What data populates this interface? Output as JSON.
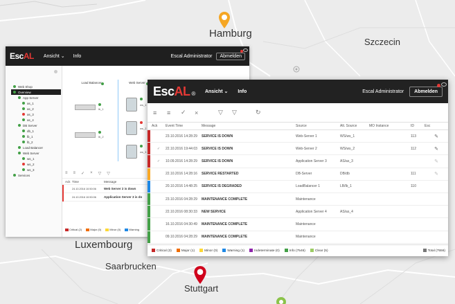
{
  "map": {
    "cities": {
      "hamburg": "Hamburg",
      "szczecin": "Szczecin",
      "luxembourg_country": "LUXEMBOURG",
      "luxembourg": "Luxembourg",
      "saarbrucken": "Saarbrucken",
      "stuttgart": "Stuttgart"
    },
    "pin_colors": {
      "hamburg": "#f5a623",
      "stuttgart": "#d0021b",
      "bottom": "#8bc34a"
    }
  },
  "back_window": {
    "logo_esc": "Esc",
    "logo_al": "AL",
    "logo_reg": "®",
    "nav_view": "Ansicht ⌄",
    "nav_info": "Info",
    "admin": "Escal Administrator",
    "logout": "Abmelden",
    "tree": [
      {
        "label": "Web Shop",
        "level": 1,
        "status": "green"
      },
      {
        "label": "Overview",
        "level": 1,
        "status": "green",
        "selected": true
      },
      {
        "label": "App Server",
        "level": 2,
        "status": "green"
      },
      {
        "label": "as_1",
        "level": 3,
        "status": "green"
      },
      {
        "label": "as_2",
        "level": 3,
        "status": "green"
      },
      {
        "label": "as_3",
        "level": 3,
        "status": "red"
      },
      {
        "label": "as_4",
        "level": 3,
        "status": "green"
      },
      {
        "label": "DB Server",
        "level": 2,
        "status": "green"
      },
      {
        "label": "db_1",
        "level": 3,
        "status": "green"
      },
      {
        "label": "lb_1",
        "level": 3,
        "status": "green"
      },
      {
        "label": "lb_2",
        "level": 3,
        "status": "green"
      },
      {
        "label": "Load Balancer",
        "level": 2,
        "status": "green"
      },
      {
        "label": "Web Server",
        "level": 2,
        "status": "green"
      },
      {
        "label": "ws_1",
        "level": 3,
        "status": "green"
      },
      {
        "label": "ws_2",
        "level": 3,
        "status": "red"
      },
      {
        "label": "ws_3",
        "level": 3,
        "status": "green"
      },
      {
        "label": "Services",
        "level": 1,
        "status": "green"
      }
    ],
    "diagram": {
      "col_lb": "Load Balancer",
      "col_web": "Web Server",
      "lb_1": "lb_1",
      "lb_2": "lb_2",
      "ws_1": "ws_1",
      "ws_2": "ws_2",
      "ws_3": "ws_3"
    },
    "alarm_columns": {
      "ack": "Ack",
      "time": "Time",
      "message": "Message"
    },
    "alarm_rows": [
      {
        "time": "24.10.2016 10:50:06",
        "message": "Web Server 2 is down"
      },
      {
        "time": "24.10.2016 10:50:06",
        "message": "Application Server 3 is do"
      }
    ],
    "legend": [
      "Critical (2)",
      "Major (0)",
      "Minor (0)",
      "Warning"
    ]
  },
  "front_window": {
    "logo_esc": "Esc",
    "logo_al": "AL",
    "logo_reg": "®",
    "nav_view": "Ansicht ⌄",
    "nav_info": "Info",
    "admin": "Escal Administrator",
    "logout": "Abmelden",
    "toolbar_icons": [
      "list-filter-icon",
      "list-filter-alt-icon",
      "check-icon",
      "close-icon",
      "funnel-icon",
      "funnel-clear-icon",
      "refresh-icon"
    ],
    "columns": {
      "ack": "Ack",
      "time": "Event Time",
      "message": "Message",
      "source": "Source",
      "alias": "Alt. Source",
      "mo": "MO Instance",
      "id": "ID",
      "esc": "Esc"
    },
    "rows": [
      {
        "severity": "#c62828",
        "ack": "",
        "time": "23.10.2016 14:28:29",
        "message": "SERVICE IS DOWN",
        "source": "Web-Server 1",
        "alias": "WS/ws_1",
        "mo": "",
        "id": "113",
        "esc": "pencil"
      },
      {
        "severity": "#c62828",
        "ack": "✓",
        "time": "22.10.2016 19:44:03",
        "message": "SERVICE IS DOWN",
        "source": "Web-Server 2",
        "alias": "WS/ws_2",
        "mo": "",
        "id": "112",
        "esc": "pencil"
      },
      {
        "severity": "#c62828",
        "ack": "✓",
        "time": "10.09.2016 14:28:29",
        "message": "SERVICE IS DOWN",
        "source": "Application Server 3",
        "alias": "AS/as_3",
        "mo": "",
        "id": "",
        "esc": "pencil-light"
      },
      {
        "severity": "#f9a825",
        "ack": "",
        "time": "22.10.2016 14:28:16",
        "message": "SERVICE RESTARTED",
        "source": "DB-Server",
        "alias": "DB/db",
        "mo": "",
        "id": "111",
        "esc": "pencil-light"
      },
      {
        "severity": "#1e88e5",
        "ack": "",
        "time": "20.10.2016 14:48:25",
        "message": "SERVICE IS DEGRADED",
        "source": "LoadBalancer 1",
        "alias": "LB/lb_1",
        "mo": "",
        "id": "110",
        "esc": ""
      },
      {
        "severity": "#43a047",
        "ack": "",
        "time": "23.10.2016 04:28:29",
        "message": "MAINTENANCE COMPLETE",
        "source": "Maintenance",
        "alias": "",
        "mo": "",
        "id": "",
        "esc": ""
      },
      {
        "severity": "#43a047",
        "ack": "",
        "time": "22.10.2016 08:30:33",
        "message": "NEW SERVICE",
        "source": "Application Server 4",
        "alias": "AS/as_4",
        "mo": "",
        "id": "",
        "esc": ""
      },
      {
        "severity": "#43a047",
        "ack": "",
        "time": "16.10.2016 04:30:49",
        "message": "MAINTENANCE COMPLETE",
        "source": "Maintenance",
        "alias": "",
        "mo": "",
        "id": "",
        "esc": ""
      },
      {
        "severity": "#43a047",
        "ack": "",
        "time": "09.10.2016 04:28:29",
        "message": "MAINTENANCE COMPLETE",
        "source": "Maintenance",
        "alias": "",
        "mo": "",
        "id": "",
        "esc": ""
      }
    ],
    "status_bar": [
      {
        "label": "Critical (3)",
        "color": "#c62828"
      },
      {
        "label": "Major (1)",
        "color": "#ef6c00"
      },
      {
        "label": "Minor (0)",
        "color": "#fdd835"
      },
      {
        "label": "Warning (1)",
        "color": "#1e88e5"
      },
      {
        "label": "Indeterminate (0)",
        "color": "#8e24aa"
      },
      {
        "label": "Info (7546)",
        "color": "#43a047"
      },
      {
        "label": "Clear (5)",
        "color": "#9ccc65"
      }
    ],
    "total": "Total (7556)"
  }
}
